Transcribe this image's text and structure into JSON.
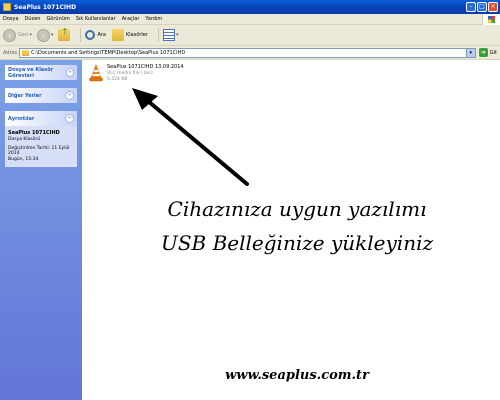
{
  "window": {
    "title": "SeaPlus 1071CIHD"
  },
  "menu": [
    "Dosya",
    "Düzen",
    "Görünüm",
    "Sık Kullanılanlar",
    "Araçlar",
    "Yardım"
  ],
  "toolbar": {
    "back_label": "Geri",
    "search_label": "Ara",
    "folders_label": "Klasörler"
  },
  "address": {
    "label": "Adres",
    "value": "C:\\Documents and Settings\\TEMP\\Desktop\\SeaPlus 1071CIHD",
    "go_label": "Git"
  },
  "sidebar": {
    "tasks_title": "Dosya ve Klasör Görevleri",
    "other_title": "Diğer Yerler",
    "details_title": "Ayrıntılar",
    "details": {
      "name": "SeaPlus 1071CIHD",
      "type": "Dosya Klasörü",
      "modified": "Değiştirilme Tarihi: 11 Eylül 2014",
      "time": "Bugün, 15:34"
    }
  },
  "file": {
    "name": "SeaPlus 1071CIHD 13.09.2014",
    "type": "VLC media file (.bin)",
    "size": "5.424 KB",
    "icon": "vlc-cone-icon"
  },
  "overlay": {
    "line1": "Cihazınıza uygun yazılımı",
    "line2": "USB Belleğinize yükleyiniz",
    "site": "www.seaplus.com.tr"
  },
  "colors": {
    "titlebar": "#0843b8",
    "sidebar": "#7ba2e7",
    "task_title": "#215dc6"
  }
}
